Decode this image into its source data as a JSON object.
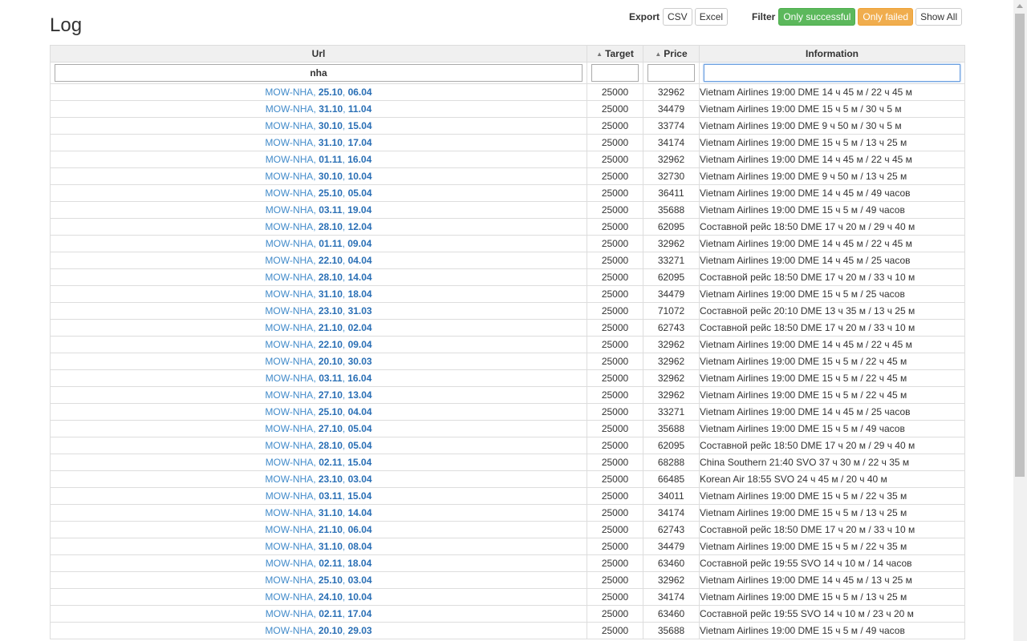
{
  "title": "Log",
  "export": {
    "label": "Export",
    "csv": "CSV",
    "excel": "Excel"
  },
  "filter": {
    "label": "Filter",
    "only_successful": "Only successful",
    "only_failed": "Only failed",
    "show_all": "Show All"
  },
  "columns": {
    "url": "Url",
    "target": "Target",
    "price": "Price",
    "information": "Information"
  },
  "filters": {
    "url": "nha",
    "target": "",
    "price": "",
    "information": ""
  },
  "rows": [
    {
      "route": "MOW-NHA",
      "d1": "25.10",
      "d2": "06.04",
      "target": "25000",
      "price": "32962",
      "info": "Vietnam Airlines 19:00 DME 14 ч 45 м / 22 ч 45 м"
    },
    {
      "route": "MOW-NHA",
      "d1": "31.10",
      "d2": "11.04",
      "target": "25000",
      "price": "34479",
      "info": "Vietnam Airlines 19:00 DME 15 ч 5 м / 30 ч 5 м"
    },
    {
      "route": "MOW-NHA",
      "d1": "30.10",
      "d2": "15.04",
      "target": "25000",
      "price": "33774",
      "info": "Vietnam Airlines 19:00 DME 9 ч 50 м / 30 ч 5 м"
    },
    {
      "route": "MOW-NHA",
      "d1": "31.10",
      "d2": "17.04",
      "target": "25000",
      "price": "34174",
      "info": "Vietnam Airlines 19:00 DME 15 ч 5 м / 13 ч 25 м"
    },
    {
      "route": "MOW-NHA",
      "d1": "01.11",
      "d2": "16.04",
      "target": "25000",
      "price": "32962",
      "info": "Vietnam Airlines 19:00 DME 14 ч 45 м / 22 ч 45 м"
    },
    {
      "route": "MOW-NHA",
      "d1": "30.10",
      "d2": "10.04",
      "target": "25000",
      "price": "32730",
      "info": "Vietnam Airlines 19:00 DME 9 ч 50 м / 13 ч 25 м"
    },
    {
      "route": "MOW-NHA",
      "d1": "25.10",
      "d2": "05.04",
      "target": "25000",
      "price": "36411",
      "info": "Vietnam Airlines 19:00 DME 14 ч 45 м / 49 часов"
    },
    {
      "route": "MOW-NHA",
      "d1": "03.11",
      "d2": "19.04",
      "target": "25000",
      "price": "35688",
      "info": "Vietnam Airlines 19:00 DME 15 ч 5 м / 49 часов"
    },
    {
      "route": "MOW-NHA",
      "d1": "28.10",
      "d2": "12.04",
      "target": "25000",
      "price": "62095",
      "info": "Составной рейс 18:50 DME 17 ч 20 м / 29 ч 40 м"
    },
    {
      "route": "MOW-NHA",
      "d1": "01.11",
      "d2": "09.04",
      "target": "25000",
      "price": "32962",
      "info": "Vietnam Airlines 19:00 DME 14 ч 45 м / 22 ч 45 м"
    },
    {
      "route": "MOW-NHA",
      "d1": "22.10",
      "d2": "04.04",
      "target": "25000",
      "price": "33271",
      "info": "Vietnam Airlines 19:00 DME 14 ч 45 м / 25 часов"
    },
    {
      "route": "MOW-NHA",
      "d1": "28.10",
      "d2": "14.04",
      "target": "25000",
      "price": "62095",
      "info": "Составной рейс 18:50 DME 17 ч 20 м / 33 ч 10 м"
    },
    {
      "route": "MOW-NHA",
      "d1": "31.10",
      "d2": "18.04",
      "target": "25000",
      "price": "34479",
      "info": "Vietnam Airlines 19:00 DME 15 ч 5 м / 25 часов"
    },
    {
      "route": "MOW-NHA",
      "d1": "23.10",
      "d2": "31.03",
      "target": "25000",
      "price": "71072",
      "info": "Составной рейс 20:10 DME 13 ч 35 м / 13 ч 25 м"
    },
    {
      "route": "MOW-NHA",
      "d1": "21.10",
      "d2": "02.04",
      "target": "25000",
      "price": "62743",
      "info": "Составной рейс 18:50 DME 17 ч 20 м / 33 ч 10 м"
    },
    {
      "route": "MOW-NHA",
      "d1": "22.10",
      "d2": "09.04",
      "target": "25000",
      "price": "32962",
      "info": "Vietnam Airlines 19:00 DME 14 ч 45 м / 22 ч 45 м"
    },
    {
      "route": "MOW-NHA",
      "d1": "20.10",
      "d2": "30.03",
      "target": "25000",
      "price": "32962",
      "info": "Vietnam Airlines 19:00 DME 15 ч 5 м / 22 ч 45 м"
    },
    {
      "route": "MOW-NHA",
      "d1": "03.11",
      "d2": "16.04",
      "target": "25000",
      "price": "32962",
      "info": "Vietnam Airlines 19:00 DME 15 ч 5 м / 22 ч 45 м"
    },
    {
      "route": "MOW-NHA",
      "d1": "27.10",
      "d2": "13.04",
      "target": "25000",
      "price": "32962",
      "info": "Vietnam Airlines 19:00 DME 15 ч 5 м / 22 ч 45 м"
    },
    {
      "route": "MOW-NHA",
      "d1": "25.10",
      "d2": "04.04",
      "target": "25000",
      "price": "33271",
      "info": "Vietnam Airlines 19:00 DME 14 ч 45 м / 25 часов"
    },
    {
      "route": "MOW-NHA",
      "d1": "27.10",
      "d2": "05.04",
      "target": "25000",
      "price": "35688",
      "info": "Vietnam Airlines 19:00 DME 15 ч 5 м / 49 часов"
    },
    {
      "route": "MOW-NHA",
      "d1": "28.10",
      "d2": "05.04",
      "target": "25000",
      "price": "62095",
      "info": "Составной рейс 18:50 DME 17 ч 20 м / 29 ч 40 м"
    },
    {
      "route": "MOW-NHA",
      "d1": "02.11",
      "d2": "15.04",
      "target": "25000",
      "price": "68288",
      "info": "China Southern 21:40 SVO 37 ч 30 м / 22 ч 35 м"
    },
    {
      "route": "MOW-NHA",
      "d1": "23.10",
      "d2": "03.04",
      "target": "25000",
      "price": "66485",
      "info": "Korean Air 18:55 SVO 24 ч 45 м / 20 ч 40 м"
    },
    {
      "route": "MOW-NHA",
      "d1": "03.11",
      "d2": "15.04",
      "target": "25000",
      "price": "34011",
      "info": "Vietnam Airlines 19:00 DME 15 ч 5 м / 22 ч 35 м"
    },
    {
      "route": "MOW-NHA",
      "d1": "31.10",
      "d2": "14.04",
      "target": "25000",
      "price": "34174",
      "info": "Vietnam Airlines 19:00 DME 15 ч 5 м / 13 ч 25 м"
    },
    {
      "route": "MOW-NHA",
      "d1": "21.10",
      "d2": "06.04",
      "target": "25000",
      "price": "62743",
      "info": "Составной рейс 18:50 DME 17 ч 20 м / 33 ч 10 м"
    },
    {
      "route": "MOW-NHA",
      "d1": "31.10",
      "d2": "08.04",
      "target": "25000",
      "price": "34479",
      "info": "Vietnam Airlines 19:00 DME 15 ч 5 м / 22 ч 35 м"
    },
    {
      "route": "MOW-NHA",
      "d1": "02.11",
      "d2": "18.04",
      "target": "25000",
      "price": "63460",
      "info": "Составной рейс 19:55 SVO 14 ч 10 м / 14 часов"
    },
    {
      "route": "MOW-NHA",
      "d1": "25.10",
      "d2": "03.04",
      "target": "25000",
      "price": "32962",
      "info": "Vietnam Airlines 19:00 DME 14 ч 45 м / 13 ч 25 м"
    },
    {
      "route": "MOW-NHA",
      "d1": "24.10",
      "d2": "10.04",
      "target": "25000",
      "price": "34174",
      "info": "Vietnam Airlines 19:00 DME 15 ч 5 м / 13 ч 25 м"
    },
    {
      "route": "MOW-NHA",
      "d1": "02.11",
      "d2": "17.04",
      "target": "25000",
      "price": "63460",
      "info": "Составной рейс 19:55 SVO 14 ч 10 м / 23 ч 20 м"
    },
    {
      "route": "MOW-NHA",
      "d1": "20.10",
      "d2": "29.03",
      "target": "25000",
      "price": "35688",
      "info": "Vietnam Airlines 19:00 DME 15 ч 5 м / 49 часов"
    }
  ]
}
